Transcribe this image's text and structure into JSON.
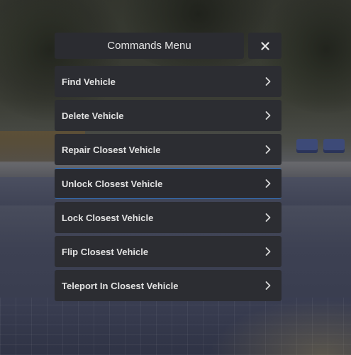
{
  "menu": {
    "title": "Commands Menu",
    "close_icon": "close-icon",
    "items": [
      {
        "label": "Find Vehicle",
        "icon": "chevron-right-icon",
        "active": false
      },
      {
        "label": "Delete Vehicle",
        "icon": "chevron-right-icon",
        "active": false
      },
      {
        "label": "Repair Closest Vehicle",
        "icon": "chevron-right-icon",
        "active": false
      },
      {
        "label": "Unlock Closest Vehicle",
        "icon": "chevron-right-icon",
        "active": true
      },
      {
        "label": "Lock Closest Vehicle",
        "icon": "chevron-right-icon",
        "active": false
      },
      {
        "label": "Flip Closest Vehicle",
        "icon": "chevron-right-icon",
        "active": false
      },
      {
        "label": "Teleport In Closest Vehicle",
        "icon": "chevron-right-icon",
        "active": false
      }
    ]
  },
  "colors": {
    "panel": "#2c2d32",
    "text": "#e2e2e2",
    "accent": "#3b7fd1"
  }
}
